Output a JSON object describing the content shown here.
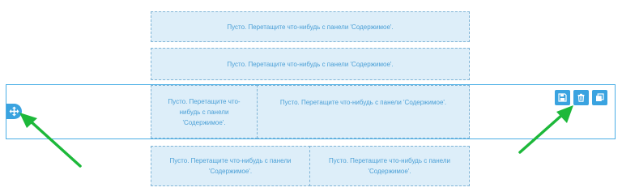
{
  "empty_placeholder_text": "Пусто. Перетащите что-нибудь с панели 'Содержимое'.",
  "rows": [
    {
      "name": "row-1",
      "columns": [
        {
          "text": "Пусто. Перетащите что-нибудь с панели 'Содержимое'."
        }
      ]
    },
    {
      "name": "row-2",
      "columns": [
        {
          "text": "Пусто. Перетащите что-нибудь с панели 'Содержимое'."
        }
      ]
    },
    {
      "name": "row-3",
      "selected": true,
      "columns": [
        {
          "text": "Пусто. Перетащите что-нибудь с панели 'Содержимое'."
        },
        {
          "text": "Пусто. Перетащите что-нибудь с панели 'Содержимое'."
        }
      ]
    },
    {
      "name": "row-4",
      "columns": [
        {
          "text": "Пусто. Перетащите что-нибудь с панели 'Содержимое'."
        },
        {
          "text": "Пусто. Перетащите что-нибудь с панели 'Содержимое'."
        }
      ]
    }
  ],
  "row_toolbar": {
    "buttons": [
      {
        "icon": "save-icon"
      },
      {
        "icon": "trash-icon"
      },
      {
        "icon": "duplicate-icon"
      }
    ]
  },
  "move_handle": {
    "icon": "move-arrows-icon"
  },
  "colors": {
    "zone_bg": "#ddeef9",
    "zone_border": "#7fb4d6",
    "zone_text": "#4a9fd6",
    "accent": "#3aa3e0",
    "selected_border": "#4aaee6",
    "annotation_arrow": "#1db83a"
  }
}
